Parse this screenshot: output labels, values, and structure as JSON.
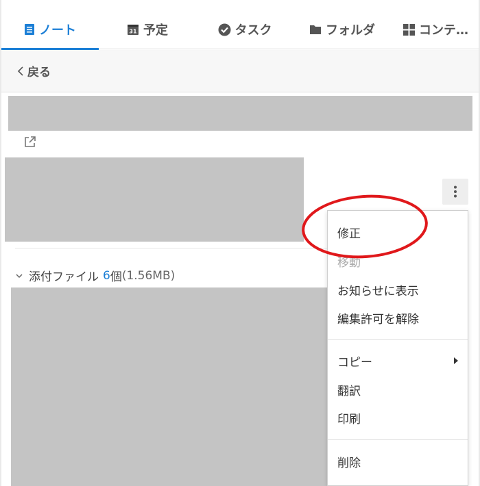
{
  "tabs": [
    {
      "label": "ノート",
      "icon": "note-icon",
      "active": true
    },
    {
      "label": "予定",
      "icon": "calendar-icon",
      "calendar_day": "31"
    },
    {
      "label": "タスク",
      "icon": "check-circle-icon"
    },
    {
      "label": "フォルダ",
      "icon": "folder-icon"
    },
    {
      "label": "コンテ…",
      "icon": "grid-icon"
    }
  ],
  "back": {
    "label": "戻る",
    "icon": "chevron-left-icon"
  },
  "attachments": {
    "label": "添付ファイル",
    "count": "6",
    "count_unit": "個",
    "size": "(1.56MB)",
    "icon": "chevron-down-icon"
  },
  "menu": {
    "items": [
      {
        "label": "修正"
      },
      {
        "label": "移動",
        "disabled": true
      },
      {
        "label": "お知らせに表示"
      },
      {
        "label": "編集許可を解除"
      },
      {
        "label": "コピー",
        "submenu": true
      },
      {
        "label": "翻訳"
      },
      {
        "label": "印刷"
      },
      {
        "label": "削除"
      }
    ]
  },
  "colors": {
    "accent": "#1c7fd6",
    "annotation": "#e0181b",
    "placeholder": "#c4c4c4"
  },
  "icons": {
    "external_link": "external-link-icon",
    "more": "more-vertical-icon",
    "submenu": "caret-right-icon"
  }
}
